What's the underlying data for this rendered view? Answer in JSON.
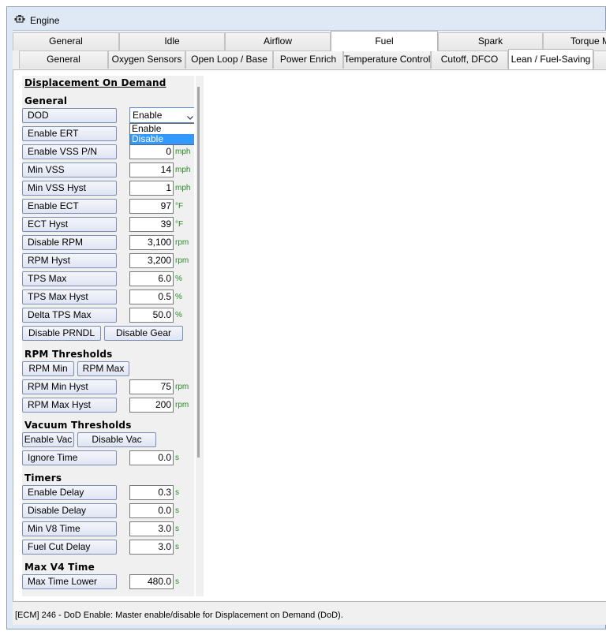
{
  "window": {
    "title": "Engine"
  },
  "tabs_top": [
    "General",
    "Idle",
    "Airflow",
    "Fuel",
    "Spark",
    "Torque Mo"
  ],
  "tabs_sub": [
    "General",
    "Oxygen Sensors",
    "Open Loop / Base",
    "Power Enrich",
    "Temperature Control",
    "Cutoff, DFCO",
    "Lean / Fuel-Saving"
  ],
  "section_title": "Displacement On Demand",
  "general": {
    "heading": "General",
    "dod_label": "DOD",
    "dod_value": "Enable",
    "dod_options": [
      "Enable",
      "Disable"
    ],
    "rows": [
      {
        "label": "Enable ERT",
        "value": "",
        "unit": ""
      },
      {
        "label": "Enable VSS P/N",
        "value": "0",
        "unit": "mph"
      },
      {
        "label": "Min VSS",
        "value": "14",
        "unit": "mph"
      },
      {
        "label": "Min VSS Hyst",
        "value": "1",
        "unit": "mph"
      },
      {
        "label": "Enable ECT",
        "value": "97",
        "unit": "°F"
      },
      {
        "label": "ECT Hyst",
        "value": "39",
        "unit": "°F"
      },
      {
        "label": "Disable RPM",
        "value": "3,100",
        "unit": "rpm"
      },
      {
        "label": "RPM Hyst",
        "value": "3,200",
        "unit": "rpm"
      },
      {
        "label": "TPS Max",
        "value": "6.0",
        "unit": "%"
      },
      {
        "label": "TPS Max Hyst",
        "value": "0.5",
        "unit": "%"
      },
      {
        "label": "Delta TPS Max",
        "value": "50.0",
        "unit": "%"
      }
    ],
    "btn_disable_prndl": "Disable PRNDL",
    "btn_disable_gear": "Disable Gear"
  },
  "rpm_thresholds": {
    "heading": "RPM Thresholds",
    "btn_min": "RPM Min",
    "btn_max": "RPM Max",
    "rows": [
      {
        "label": "RPM Min Hyst",
        "value": "75",
        "unit": "rpm"
      },
      {
        "label": "RPM Max Hyst",
        "value": "200",
        "unit": "rpm"
      }
    ]
  },
  "vacuum_thresholds": {
    "heading": "Vacuum Thresholds",
    "btn_enable": "Enable Vac",
    "btn_disable": "Disable Vac",
    "rows": [
      {
        "label": "Ignore Time",
        "value": "0.0",
        "unit": "s"
      }
    ]
  },
  "timers": {
    "heading": "Timers",
    "rows": [
      {
        "label": "Enable Delay",
        "value": "0.3",
        "unit": "s"
      },
      {
        "label": "Disable Delay",
        "value": "0.0",
        "unit": "s"
      },
      {
        "label": "Min V8 Time",
        "value": "3.0",
        "unit": "s"
      },
      {
        "label": "Fuel Cut Delay",
        "value": "3.0",
        "unit": "s"
      }
    ]
  },
  "max_v4": {
    "heading": "Max V4 Time",
    "rows": [
      {
        "label": "Max Time Lower",
        "value": "480.0",
        "unit": "s"
      }
    ]
  },
  "status": "[ECM] 246 - DoD Enable: Master enable/disable for Displacement on Demand (DoD).",
  "icons": {
    "app": "engine-icon",
    "chevron": "chevron-down-icon"
  }
}
